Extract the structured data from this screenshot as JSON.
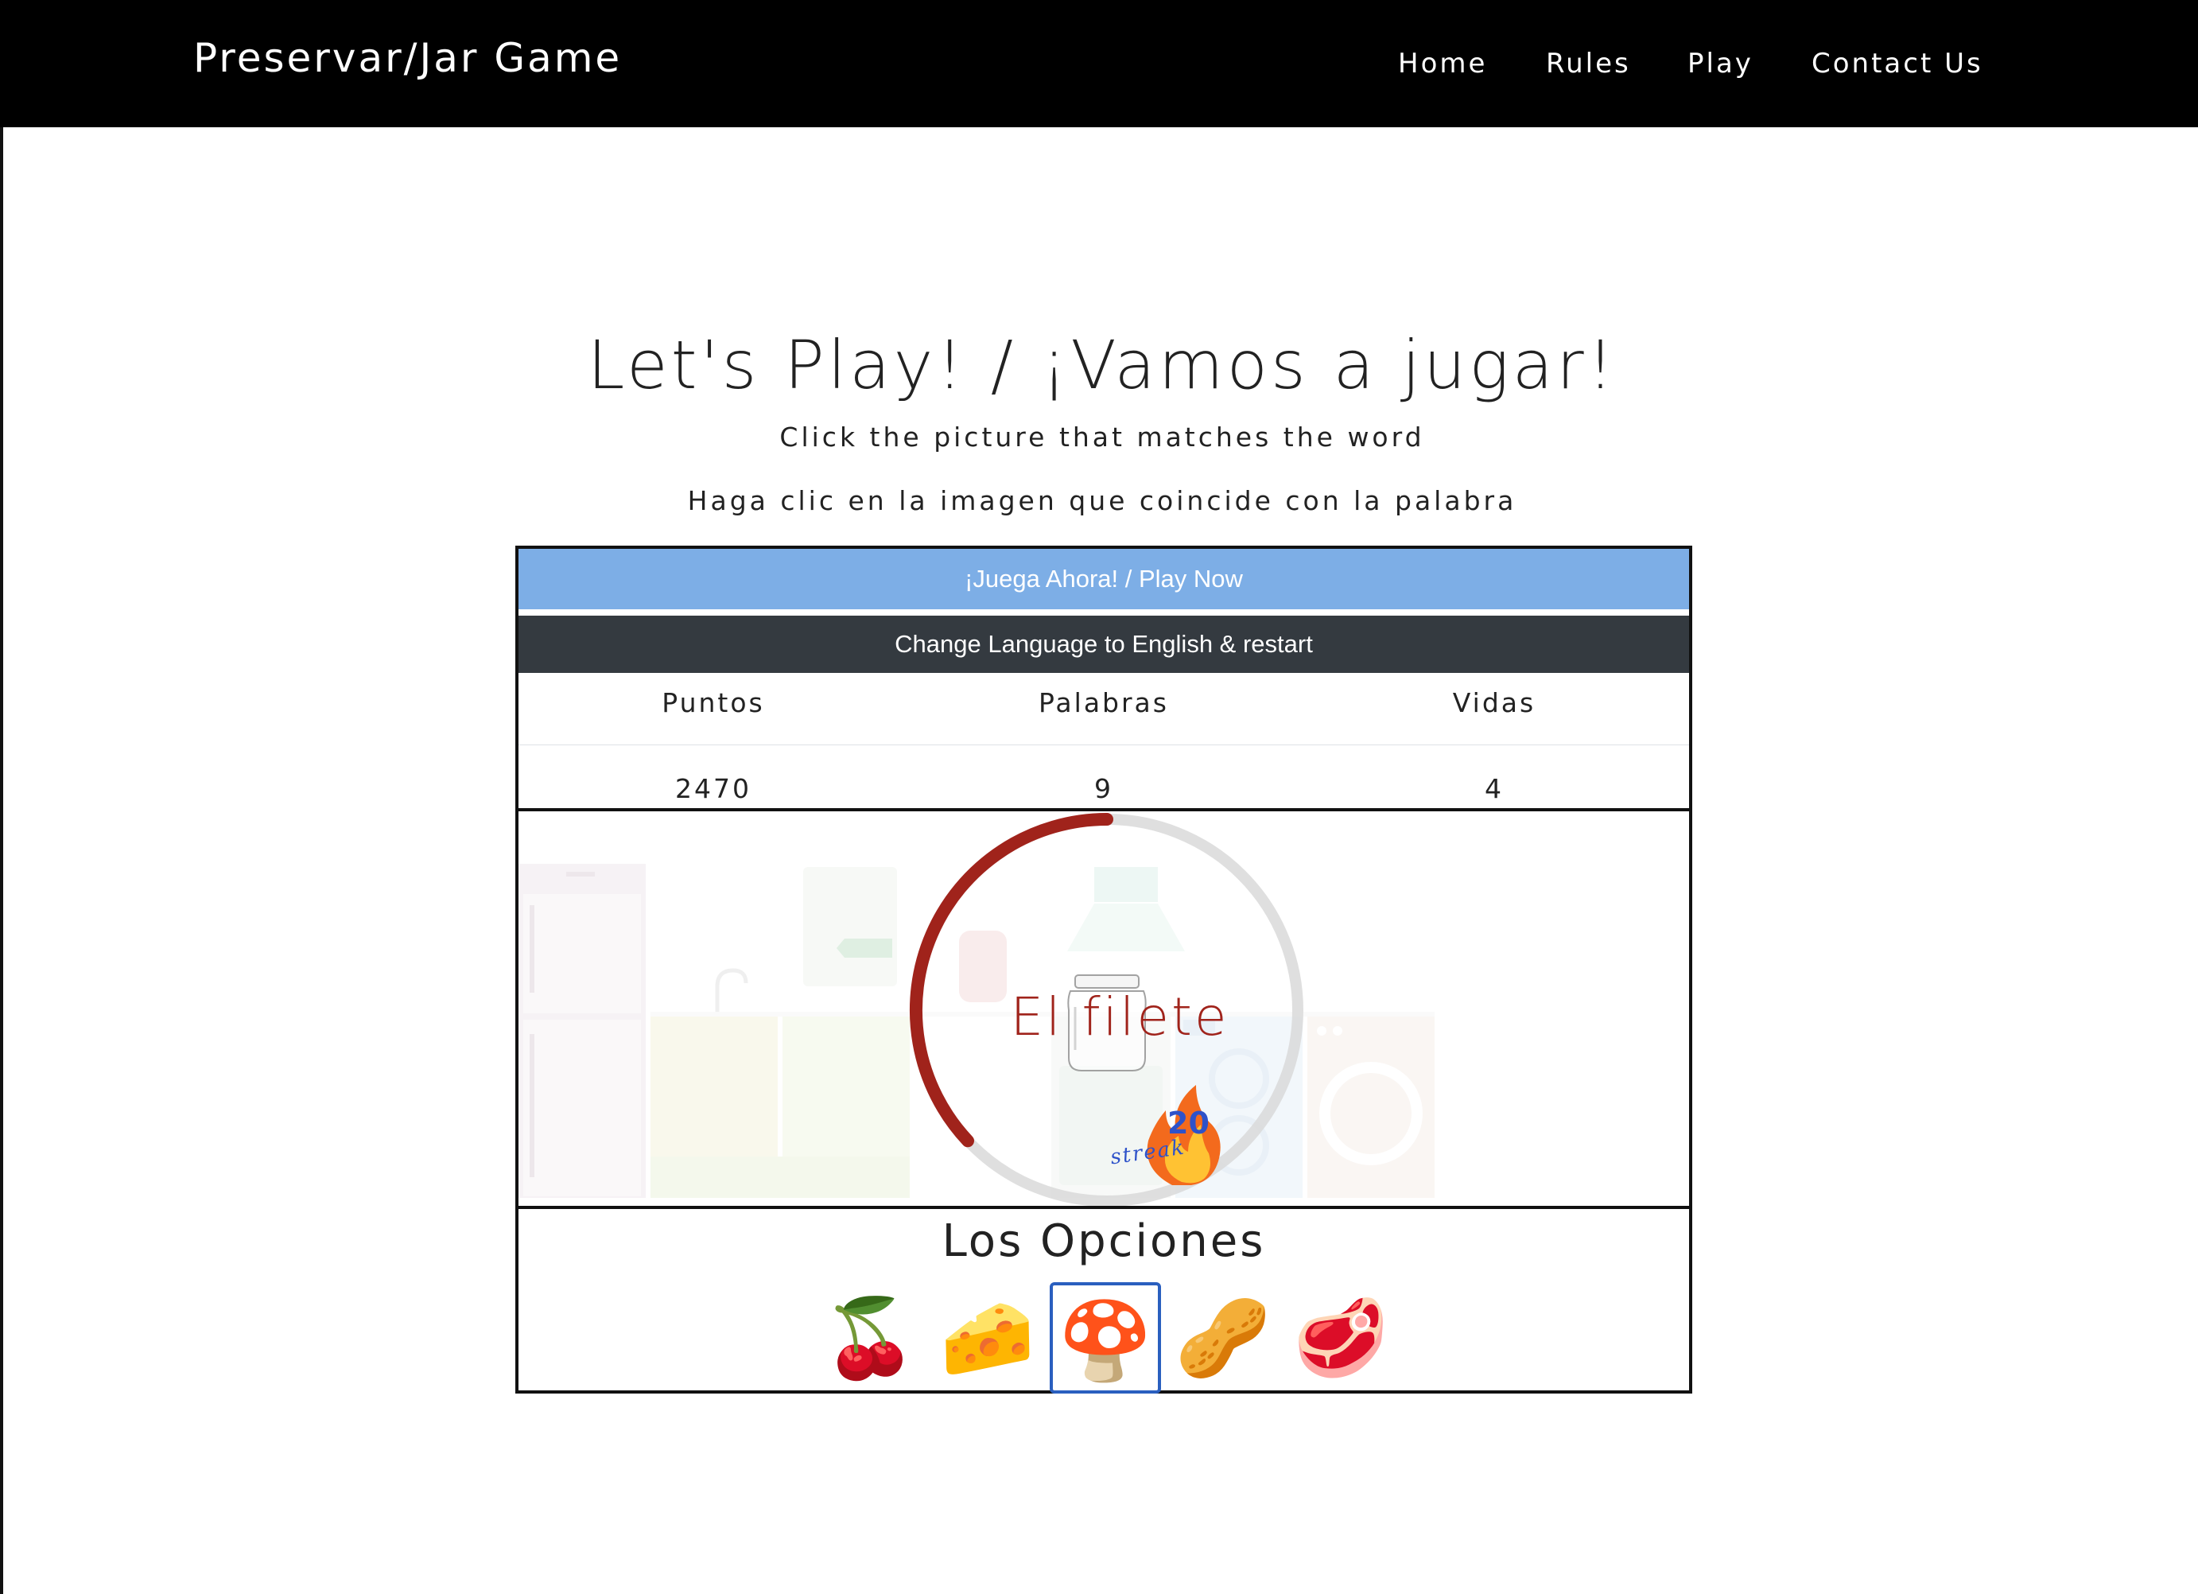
{
  "navbar": {
    "brand": "Preservar/Jar Game",
    "links": [
      {
        "label": "Home"
      },
      {
        "label": "Rules"
      },
      {
        "label": "Play"
      },
      {
        "label": "Contact Us"
      }
    ]
  },
  "header": {
    "title": "Let's Play! / ¡Vamos a jugar!",
    "instruction_en": "Click the picture that matches the word",
    "instruction_es": "Haga clic en la imagen que coincide con la palabra"
  },
  "game": {
    "play_button": "¡Juega Ahora! / Play Now",
    "language_button": "Change Language to English & restart",
    "stats": {
      "headers": [
        "Puntos",
        "Palabras",
        "Vidas"
      ],
      "values": [
        "2470",
        "9",
        "4"
      ]
    },
    "current_word": "El filete",
    "timer_fraction_remaining": 0.37,
    "streak": {
      "count": "20",
      "label": "streak"
    },
    "options_title": "Los Opciones",
    "options": [
      {
        "emoji": "🍒",
        "name": "cherry-icon",
        "selected": false
      },
      {
        "emoji": "🧀",
        "name": "cheese-icon",
        "selected": false
      },
      {
        "emoji": "🍄",
        "name": "mushroom-icon",
        "selected": true
      },
      {
        "emoji": "🥜",
        "name": "peanut-icon",
        "selected": false
      },
      {
        "emoji": "🥩",
        "name": "steak-icon",
        "selected": false
      }
    ]
  },
  "colors": {
    "navbar_bg": "#000000",
    "play_button_bg": "#7daee6",
    "language_button_bg": "#343a40",
    "timer_color": "#a0231b",
    "timer_track": "#d9d9d9",
    "selected_border": "#2a5fbf"
  }
}
